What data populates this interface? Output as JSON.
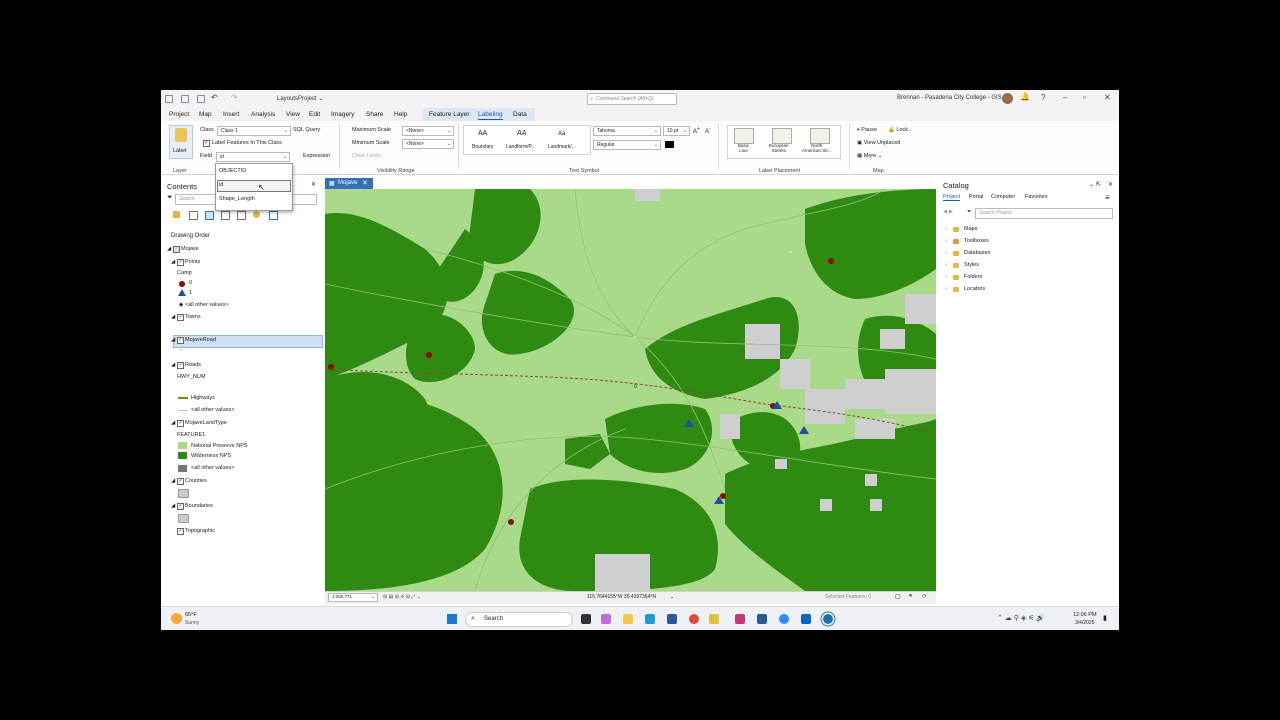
{
  "titlebar": {
    "project": "LayoutsProject ⌄",
    "command_search_placeholder": "Command Search (Alt+Q)",
    "user": "Brennan - Pasadena City College - GIS",
    "help": "?"
  },
  "menu": {
    "tabs": [
      "Project",
      "Map",
      "Insert",
      "Analysis",
      "View",
      "Edit",
      "Imagery",
      "Share",
      "Help"
    ],
    "context_tabs": [
      "Feature Layer",
      "Labeling",
      "Data"
    ]
  },
  "ribbon": {
    "label_button": "Label",
    "class_label": "Class",
    "class_value": "Class 1",
    "sql_query": "SQL Query",
    "label_features_check": "Label Features In This Class",
    "field_label": "Field",
    "field_value": "id",
    "expression": "Expression",
    "max_scale_label": "Maximum Scale",
    "max_scale_value": "<None>",
    "min_scale_label": "Minimum Scale",
    "min_scale_value": "<None>",
    "clear_limits": "Clear Limits",
    "styles": [
      "Boundary",
      "Landform/P...",
      "Landmark/..."
    ],
    "style_glyph": "AA",
    "style_glyph_small": "Aa",
    "font_name": "Tahoma",
    "font_size": "10 pt",
    "font_style": "Regular",
    "placements": [
      [
        "Basic",
        "Line"
      ],
      [
        "European",
        "Streets"
      ],
      [
        "North",
        "American Str..."
      ]
    ],
    "pause": "Pause",
    "lock": "Lock",
    "view_unplaced": "View Unplaced",
    "more": "More ⌄",
    "groups": [
      "Layer",
      "Visibility Range",
      "Text Symbol",
      "Label Placement",
      "Map"
    ]
  },
  "field_dropdown": {
    "options": [
      "OBJECTID",
      "id",
      "Shape_Length"
    ],
    "highlighted": "id"
  },
  "contents": {
    "title": "Contents",
    "search_placeholder": "Search",
    "drawing_order": "Drawing Order",
    "map_name": "Mojave",
    "points_layer": "Points",
    "points_field": "Camp",
    "camp_values": [
      "0",
      "1"
    ],
    "all_other": "<all other values>",
    "towns_layer": "Towns",
    "road_layer": "MojaveRoad",
    "road_symbol": "~",
    "roads_layer": "Roads",
    "roads_field": "HWY_NUM",
    "highways": "Highways",
    "landtype_layer": "MojaveLandType",
    "landtype_field": "FEATURE1",
    "preserve": "National Preserve NPS",
    "wilderness": "Wilderness NPS",
    "counties_layer": "Counties",
    "boundaries_layer": "Boundaries",
    "topo_layer": "Topographic"
  },
  "map": {
    "tab": "Mojave",
    "scale": "1:255,771",
    "coords": "115.7644155°W 35.4397364°N",
    "selected": "Selected Features: 0",
    "label_zero": "0"
  },
  "catalog": {
    "title": "Catalog",
    "tabs": [
      "Project",
      "Portal",
      "Computer",
      "Favorites"
    ],
    "search_placeholder": "Search Project",
    "items": [
      "Maps",
      "Toolboxes",
      "Databases",
      "Styles",
      "Folders",
      "Locators"
    ]
  },
  "taskbar": {
    "temp": "65°F",
    "weather": "Sunny",
    "search": "Search",
    "time": "12:06 PM",
    "date": "3/4/2025"
  },
  "colors": {
    "preserve": "#a8da8a",
    "wilderness": "#2f8a12",
    "accent": "#3270b8",
    "camp0": "#8b0a0a",
    "camp1": "#1f4fa0"
  }
}
